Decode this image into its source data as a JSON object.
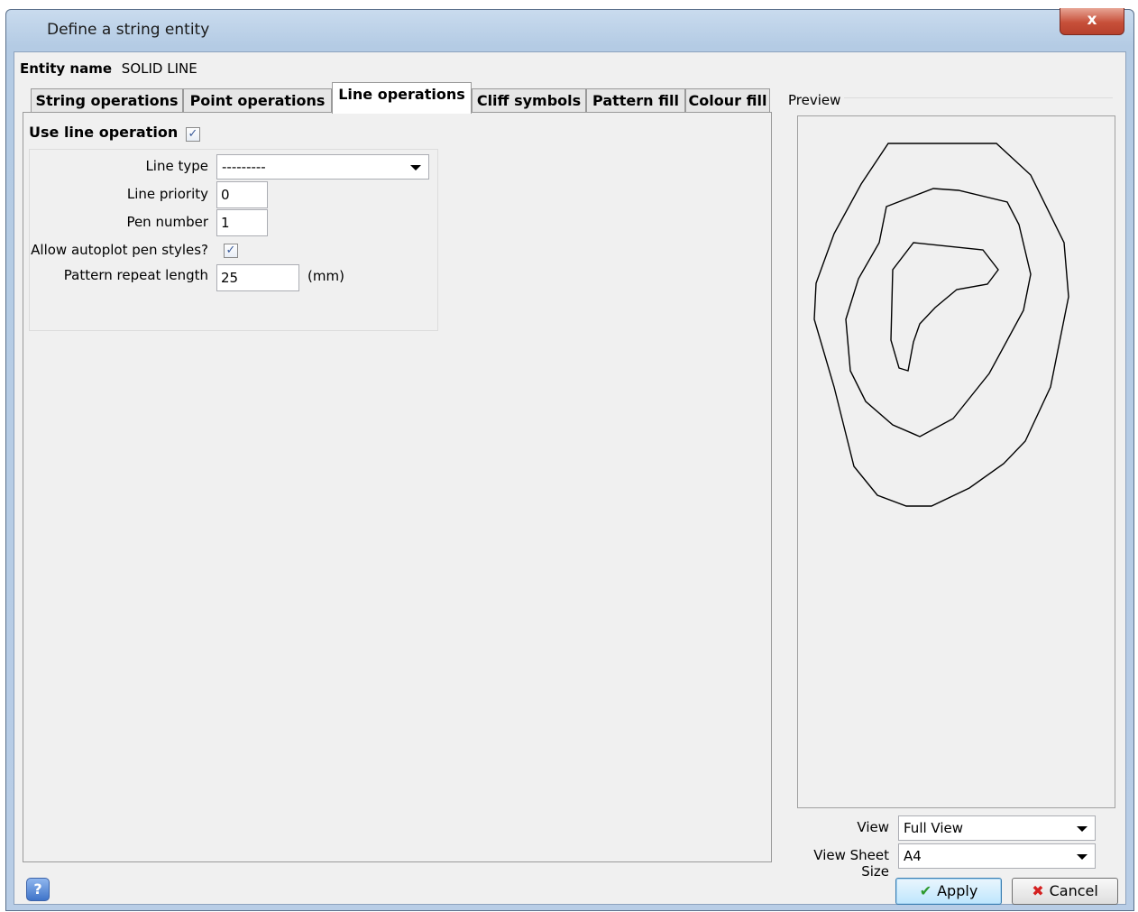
{
  "window": {
    "title": "Define a string entity",
    "close_label": "x"
  },
  "entity": {
    "label": "Entity name",
    "value": "SOLID LINE"
  },
  "tabs": [
    {
      "label": "String operations",
      "active": false
    },
    {
      "label": "Point operations",
      "active": false
    },
    {
      "label": "Line operations",
      "active": true
    },
    {
      "label": "Cliff symbols",
      "active": false
    },
    {
      "label": "Pattern fill",
      "active": false
    },
    {
      "label": "Colour fill",
      "active": false
    }
  ],
  "line_ops": {
    "use_label": "Use line operation",
    "use_checked": true,
    "line_type_label": "Line type",
    "line_type_value": "---------",
    "priority_label": "Line priority",
    "priority_value": "0",
    "pen_label": "Pen number",
    "pen_value": "1",
    "autoplot_label": "Allow autoplot pen styles?",
    "autoplot_checked": true,
    "repeat_label": "Pattern repeat length",
    "repeat_value": "25",
    "repeat_unit": "(mm)"
  },
  "preview": {
    "label": "Preview",
    "view_label": "View",
    "view_value": "Full View",
    "sheet_label": "View Sheet Size",
    "sheet_value": "A4"
  },
  "footer": {
    "help_label": "?",
    "apply_label": "Apply",
    "cancel_label": "Cancel"
  },
  "icons": {
    "check": "check-icon",
    "apply": "green-checkmark-icon",
    "cancel": "red-x-icon",
    "help": "help-icon",
    "dropdown": "chevron-down-icon"
  }
}
